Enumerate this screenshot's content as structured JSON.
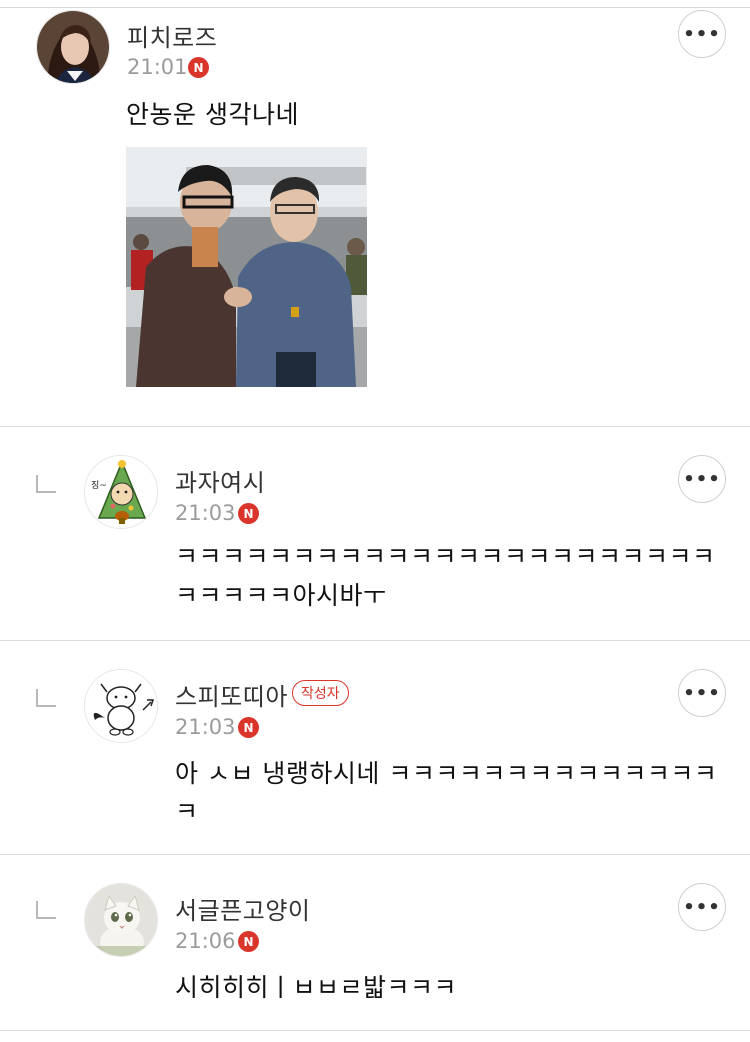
{
  "comments": [
    {
      "nickname": "피치로즈",
      "time": "21:01",
      "badge": "N",
      "text": "안농운 생각나네",
      "avatar_icon": "woman-portrait-avatar",
      "has_photo": true,
      "photo_icon": "handshake-photo"
    },
    {
      "nickname": "과자여시",
      "time": "21:03",
      "badge": "N",
      "text_line1": "ㅋㅋㅋㅋㅋㅋㅋㅋㅋㅋㅋㅋㅋㅋㅋㅋㅋㅋㅋㅋㅋㅋㅋ",
      "text_line2": "ㅋㅋㅋㅋㅋ아시바ㅜ",
      "avatar_icon": "christmas-tree-character-avatar",
      "avatar_caption": "징~"
    },
    {
      "nickname": "스피또띠아",
      "author_label": "작성자",
      "time": "21:03",
      "badge": "N",
      "text_line1": "아 ㅅㅂ 냉랭하시네 ㅋㅋㅋㅋㅋㅋㅋㅋㅋㅋㅋㅋㅋㅋ",
      "text_line2": "ㅋ",
      "avatar_icon": "devil-cow-avatar"
    },
    {
      "nickname": "서글픈고양이",
      "time": "21:06",
      "badge": "N",
      "text": "시히히히ㅣㅂㅂㄹ밟ㅋㅋㅋ",
      "avatar_icon": "sad-cat-avatar"
    }
  ],
  "more_button_label": "•••",
  "colors": {
    "badge_red": "#d9352b",
    "time_gray": "#9b9b9b",
    "divider": "#dcdcdc"
  }
}
